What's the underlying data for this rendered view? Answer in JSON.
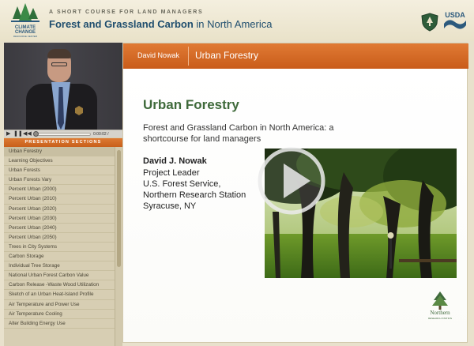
{
  "header": {
    "logo_text": "CLIMATE\nCHANGE",
    "logo_sub": "RESOURCE CENTER",
    "tagline": "A SHORT COURSE FOR LAND MANAGERS",
    "title_bold": "Forest and Grassland Carbon",
    "title_light": " in North America",
    "agency_right": "USDA"
  },
  "player": {
    "time": "0:00:02 / 0:10:44",
    "progress_fraction": 0.003
  },
  "sections": {
    "header": "PRESENTATION SECTIONS",
    "items": [
      "Urban Forestry",
      "Learning Objectives",
      "Urban Forests",
      "Urban Forests Vary",
      "Percent Urban (2000)",
      "Percent Urban (2010)",
      "Percent Urban (2020)",
      "Percent Urban (2030)",
      "Percent Urban (2040)",
      "Percent Urban (2050)",
      "Trees in City Systems",
      "Carbon Storage",
      "Individual Tree Storage",
      "National Urban Forest Carbon Value",
      "Carbon Release -Waste Wood Utilization",
      "Sketch of an Urban Heat-Island Profile",
      "Air Temperature and Power Use",
      "Air Temperature Cooling",
      "Alter Building Energy Use"
    ]
  },
  "slide": {
    "presenter": "David Nowak",
    "bar_title": "Urban Forestry",
    "title": "Urban Forestry",
    "subtitle": "Forest and Grassland Carbon in North America: a shortcourse for land managers",
    "author": "David J. Nowak",
    "role": "Project Leader",
    "org": "U.S. Forest Service,",
    "station": "Northern Research Station",
    "city": "Syracuse, NY",
    "nrs_name": "Northern",
    "nrs_sub": "RESEARCH STATION"
  },
  "colors": {
    "accent_orange": "#d66a25",
    "title_green": "#3f6a3b",
    "header_blue": "#1f4e6e"
  }
}
